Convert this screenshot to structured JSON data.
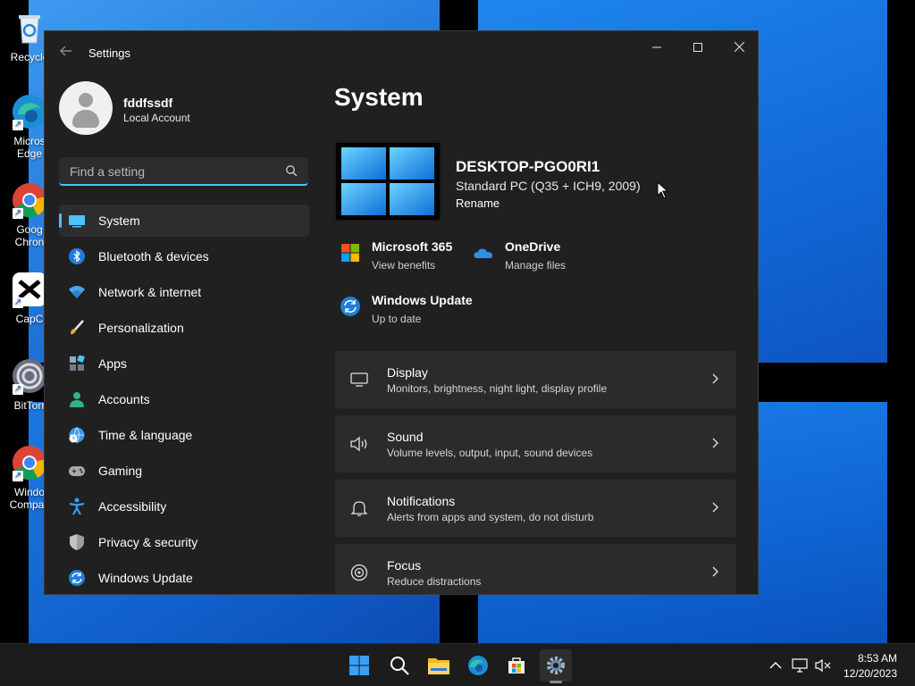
{
  "desktop": {
    "icons": [
      {
        "label": "Recycle",
        "icon": "recycle-bin-icon"
      },
      {
        "label": "Micros Edge",
        "icon": "edge-icon"
      },
      {
        "label": "Goog Chron",
        "icon": "chrome-icon"
      },
      {
        "label": "CapC",
        "icon": "capcut-icon"
      },
      {
        "label": "BitTorr",
        "icon": "bittorrent-icon"
      },
      {
        "label": "Windo Compati",
        "icon": "chrome-icon"
      }
    ]
  },
  "window": {
    "title": "Settings",
    "controls": {
      "minimize": "—",
      "maximize": "☐",
      "close": "✕"
    }
  },
  "account": {
    "name": "fddfssdf",
    "type": "Local Account"
  },
  "search": {
    "placeholder": "Find a setting"
  },
  "sidebar": {
    "items": [
      {
        "label": "System",
        "icon": "display-icon",
        "active": true
      },
      {
        "label": "Bluetooth & devices",
        "icon": "bluetooth-icon"
      },
      {
        "label": "Network & internet",
        "icon": "wifi-icon"
      },
      {
        "label": "Personalization",
        "icon": "brush-icon"
      },
      {
        "label": "Apps",
        "icon": "apps-icon"
      },
      {
        "label": "Accounts",
        "icon": "person-icon"
      },
      {
        "label": "Time & language",
        "icon": "globe-clock-icon"
      },
      {
        "label": "Gaming",
        "icon": "gamepad-icon"
      },
      {
        "label": "Accessibility",
        "icon": "accessibility-icon"
      },
      {
        "label": "Privacy & security",
        "icon": "shield-icon"
      },
      {
        "label": "Windows Update",
        "icon": "update-icon"
      }
    ]
  },
  "main": {
    "title": "System",
    "device": {
      "name": "DESKTOP-PGO0RI1",
      "model": "Standard PC (Q35 + ICH9, 2009)",
      "rename": "Rename"
    },
    "quick_links": [
      {
        "title": "Microsoft 365",
        "subtitle": "View benefits",
        "icon": "microsoft-logo-icon"
      },
      {
        "title": "OneDrive",
        "subtitle": "Manage files",
        "icon": "onedrive-cloud-icon"
      },
      {
        "title": "Windows Update",
        "subtitle": "Up to date",
        "icon": "update-icon"
      }
    ],
    "cards": [
      {
        "title": "Display",
        "subtitle": "Monitors, brightness, night light, display profile",
        "icon": "monitor-icon"
      },
      {
        "title": "Sound",
        "subtitle": "Volume levels, output, input, sound devices",
        "icon": "speaker-icon"
      },
      {
        "title": "Notifications",
        "subtitle": "Alerts from apps and system, do not disturb",
        "icon": "bell-icon"
      },
      {
        "title": "Focus",
        "subtitle": "Reduce distractions",
        "icon": "focus-icon"
      }
    ]
  },
  "taskbar": {
    "apps": [
      "start-icon",
      "search-icon",
      "file-explorer-icon",
      "edge-icon",
      "store-icon",
      "settings-icon"
    ],
    "clock": {
      "time": "8:53 AM",
      "date": "12/20/2023"
    }
  },
  "colors": {
    "accent": "#4cc2ff",
    "window_bg": "#202020",
    "card_bg": "#2b2b2b"
  }
}
